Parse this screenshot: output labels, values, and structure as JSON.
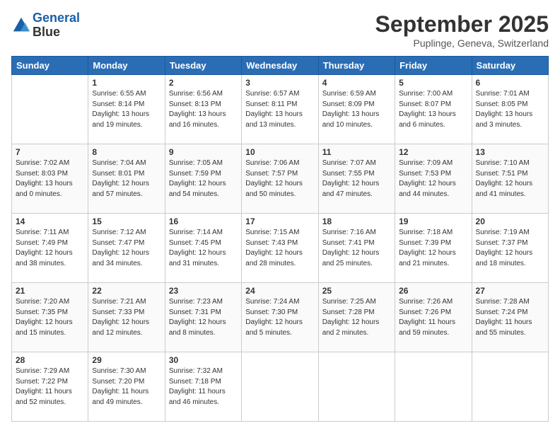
{
  "header": {
    "logo_line1": "General",
    "logo_line2": "Blue",
    "month": "September 2025",
    "location": "Puplinge, Geneva, Switzerland"
  },
  "weekdays": [
    "Sunday",
    "Monday",
    "Tuesday",
    "Wednesday",
    "Thursday",
    "Friday",
    "Saturday"
  ],
  "weeks": [
    [
      {
        "day": "",
        "info": ""
      },
      {
        "day": "1",
        "info": "Sunrise: 6:55 AM\nSunset: 8:14 PM\nDaylight: 13 hours\nand 19 minutes."
      },
      {
        "day": "2",
        "info": "Sunrise: 6:56 AM\nSunset: 8:13 PM\nDaylight: 13 hours\nand 16 minutes."
      },
      {
        "day": "3",
        "info": "Sunrise: 6:57 AM\nSunset: 8:11 PM\nDaylight: 13 hours\nand 13 minutes."
      },
      {
        "day": "4",
        "info": "Sunrise: 6:59 AM\nSunset: 8:09 PM\nDaylight: 13 hours\nand 10 minutes."
      },
      {
        "day": "5",
        "info": "Sunrise: 7:00 AM\nSunset: 8:07 PM\nDaylight: 13 hours\nand 6 minutes."
      },
      {
        "day": "6",
        "info": "Sunrise: 7:01 AM\nSunset: 8:05 PM\nDaylight: 13 hours\nand 3 minutes."
      }
    ],
    [
      {
        "day": "7",
        "info": "Sunrise: 7:02 AM\nSunset: 8:03 PM\nDaylight: 13 hours\nand 0 minutes."
      },
      {
        "day": "8",
        "info": "Sunrise: 7:04 AM\nSunset: 8:01 PM\nDaylight: 12 hours\nand 57 minutes."
      },
      {
        "day": "9",
        "info": "Sunrise: 7:05 AM\nSunset: 7:59 PM\nDaylight: 12 hours\nand 54 minutes."
      },
      {
        "day": "10",
        "info": "Sunrise: 7:06 AM\nSunset: 7:57 PM\nDaylight: 12 hours\nand 50 minutes."
      },
      {
        "day": "11",
        "info": "Sunrise: 7:07 AM\nSunset: 7:55 PM\nDaylight: 12 hours\nand 47 minutes."
      },
      {
        "day": "12",
        "info": "Sunrise: 7:09 AM\nSunset: 7:53 PM\nDaylight: 12 hours\nand 44 minutes."
      },
      {
        "day": "13",
        "info": "Sunrise: 7:10 AM\nSunset: 7:51 PM\nDaylight: 12 hours\nand 41 minutes."
      }
    ],
    [
      {
        "day": "14",
        "info": "Sunrise: 7:11 AM\nSunset: 7:49 PM\nDaylight: 12 hours\nand 38 minutes."
      },
      {
        "day": "15",
        "info": "Sunrise: 7:12 AM\nSunset: 7:47 PM\nDaylight: 12 hours\nand 34 minutes."
      },
      {
        "day": "16",
        "info": "Sunrise: 7:14 AM\nSunset: 7:45 PM\nDaylight: 12 hours\nand 31 minutes."
      },
      {
        "day": "17",
        "info": "Sunrise: 7:15 AM\nSunset: 7:43 PM\nDaylight: 12 hours\nand 28 minutes."
      },
      {
        "day": "18",
        "info": "Sunrise: 7:16 AM\nSunset: 7:41 PM\nDaylight: 12 hours\nand 25 minutes."
      },
      {
        "day": "19",
        "info": "Sunrise: 7:18 AM\nSunset: 7:39 PM\nDaylight: 12 hours\nand 21 minutes."
      },
      {
        "day": "20",
        "info": "Sunrise: 7:19 AM\nSunset: 7:37 PM\nDaylight: 12 hours\nand 18 minutes."
      }
    ],
    [
      {
        "day": "21",
        "info": "Sunrise: 7:20 AM\nSunset: 7:35 PM\nDaylight: 12 hours\nand 15 minutes."
      },
      {
        "day": "22",
        "info": "Sunrise: 7:21 AM\nSunset: 7:33 PM\nDaylight: 12 hours\nand 12 minutes."
      },
      {
        "day": "23",
        "info": "Sunrise: 7:23 AM\nSunset: 7:31 PM\nDaylight: 12 hours\nand 8 minutes."
      },
      {
        "day": "24",
        "info": "Sunrise: 7:24 AM\nSunset: 7:30 PM\nDaylight: 12 hours\nand 5 minutes."
      },
      {
        "day": "25",
        "info": "Sunrise: 7:25 AM\nSunset: 7:28 PM\nDaylight: 12 hours\nand 2 minutes."
      },
      {
        "day": "26",
        "info": "Sunrise: 7:26 AM\nSunset: 7:26 PM\nDaylight: 11 hours\nand 59 minutes."
      },
      {
        "day": "27",
        "info": "Sunrise: 7:28 AM\nSunset: 7:24 PM\nDaylight: 11 hours\nand 55 minutes."
      }
    ],
    [
      {
        "day": "28",
        "info": "Sunrise: 7:29 AM\nSunset: 7:22 PM\nDaylight: 11 hours\nand 52 minutes."
      },
      {
        "day": "29",
        "info": "Sunrise: 7:30 AM\nSunset: 7:20 PM\nDaylight: 11 hours\nand 49 minutes."
      },
      {
        "day": "30",
        "info": "Sunrise: 7:32 AM\nSunset: 7:18 PM\nDaylight: 11 hours\nand 46 minutes."
      },
      {
        "day": "",
        "info": ""
      },
      {
        "day": "",
        "info": ""
      },
      {
        "day": "",
        "info": ""
      },
      {
        "day": "",
        "info": ""
      }
    ]
  ]
}
